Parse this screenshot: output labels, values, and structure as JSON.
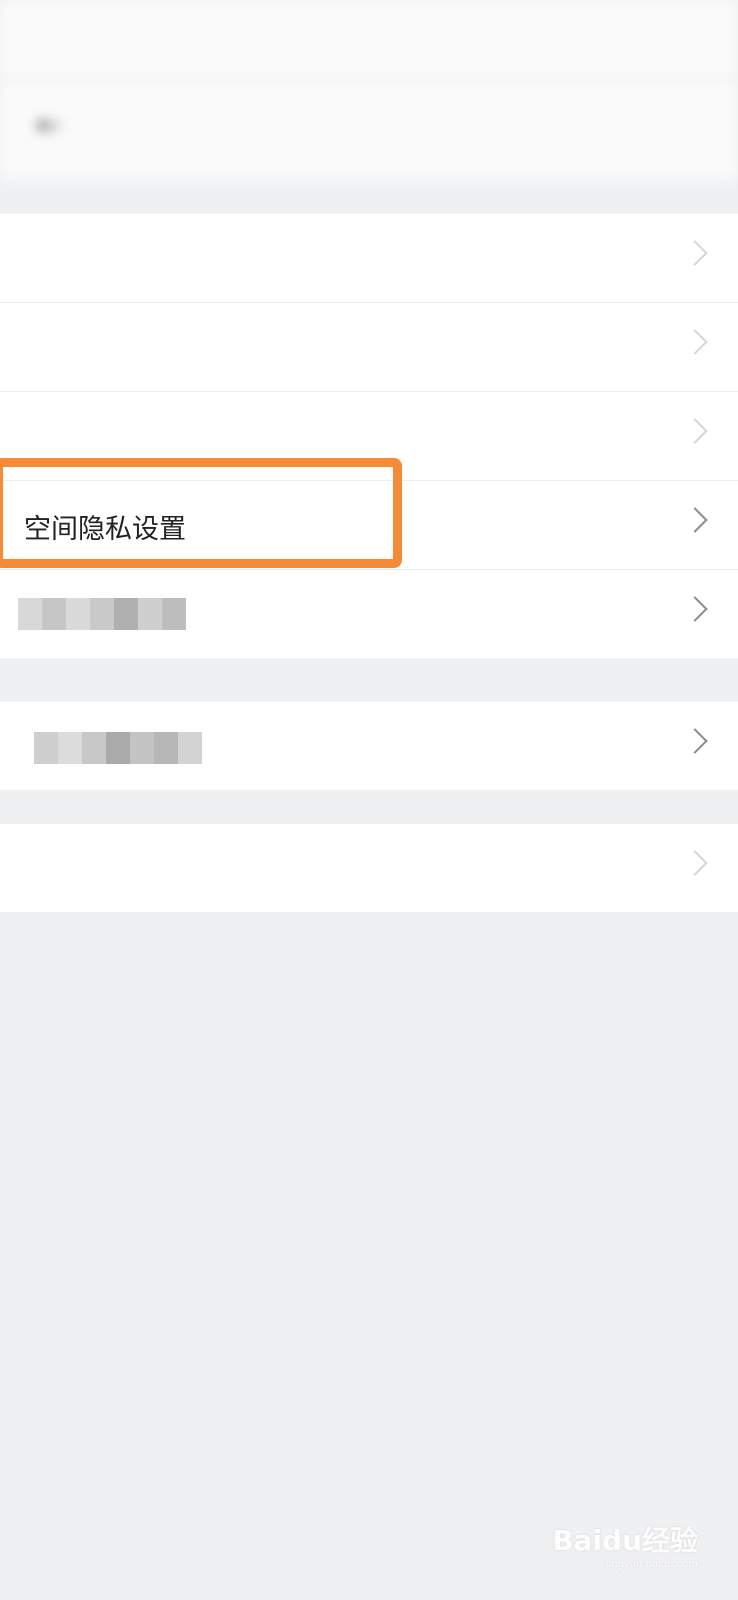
{
  "status_bar": {
    "left_text": "",
    "right_text": ""
  },
  "header": {
    "back_icon": "back-arrow-icon",
    "title": ""
  },
  "groups": [
    {
      "items": [
        {
          "label": "",
          "obscured": true
        },
        {
          "label": "",
          "obscured": true
        },
        {
          "label": "",
          "obscured": true
        },
        {
          "label": "空间隐私设置",
          "highlighted": true
        },
        {
          "label": "",
          "pixelated": true
        }
      ]
    },
    {
      "items": [
        {
          "label": "",
          "pixelated": true
        }
      ]
    },
    {
      "items": [
        {
          "label": "",
          "obscured": true
        }
      ]
    }
  ],
  "highlight_color": "#f58a37",
  "watermark": {
    "brand": "Baidu经验",
    "url": "jingyan.baidu.com"
  }
}
